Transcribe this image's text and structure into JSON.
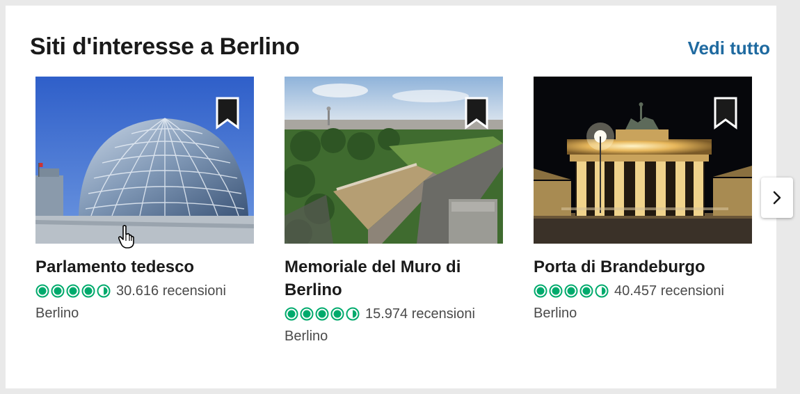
{
  "section": {
    "title": "Siti d'interesse a Berlino",
    "see_all": "Vedi tutto"
  },
  "cards": [
    {
      "name": "Parlamento tedesco",
      "rating": 4.5,
      "reviews": "30.616 recensioni",
      "location": "Berlino",
      "image": "reichstag-glass-dome"
    },
    {
      "name": "Memoriale del Muro di Berlino",
      "rating": 4.5,
      "reviews": "15.974 recensioni",
      "location": "Berlino",
      "image": "berlin-wall-memorial-aerial"
    },
    {
      "name": "Porta di Brandeburgo",
      "rating": 4.5,
      "reviews": "40.457 recensioni",
      "location": "Berlino",
      "image": "brandenburg-gate-night"
    }
  ],
  "colors": {
    "rating_green": "#00aa6c",
    "link_blue": "#1f6aa0"
  },
  "icons": {
    "save": "bookmark-icon",
    "next": "chevron-right-icon"
  }
}
